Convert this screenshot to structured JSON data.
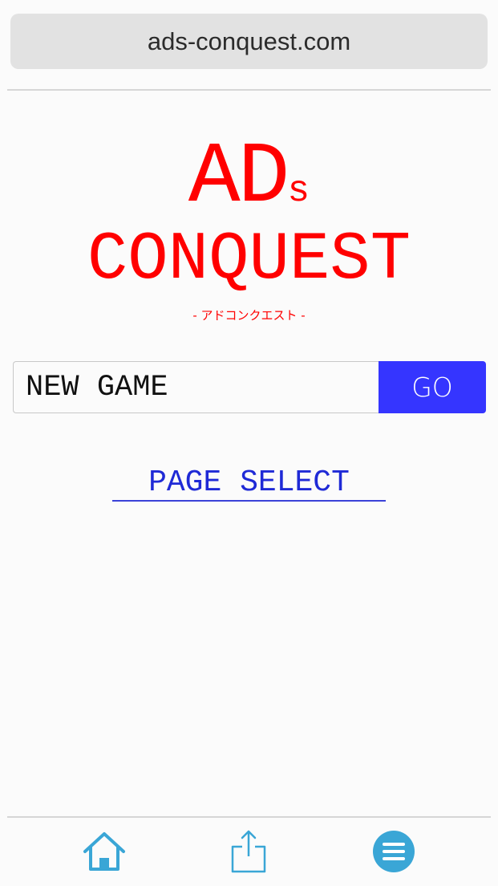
{
  "browser": {
    "url": "ads-conquest.com"
  },
  "logo": {
    "line1_main": "AD",
    "line1_suffix": "s",
    "line2": "CONQUEST",
    "subtitle": "- アドコンクエスト -"
  },
  "newgame": {
    "input_value": "NEW GAME",
    "go_label": "GO"
  },
  "links": {
    "page_select": "PAGE SELECT"
  },
  "toolbar": {
    "icons": [
      "home-icon",
      "share-icon",
      "menu-icon"
    ]
  },
  "colors": {
    "logo": "#ff0000",
    "go_button": "#3535ff",
    "link": "#1f2ad6",
    "icon": "#3aa6d6"
  }
}
